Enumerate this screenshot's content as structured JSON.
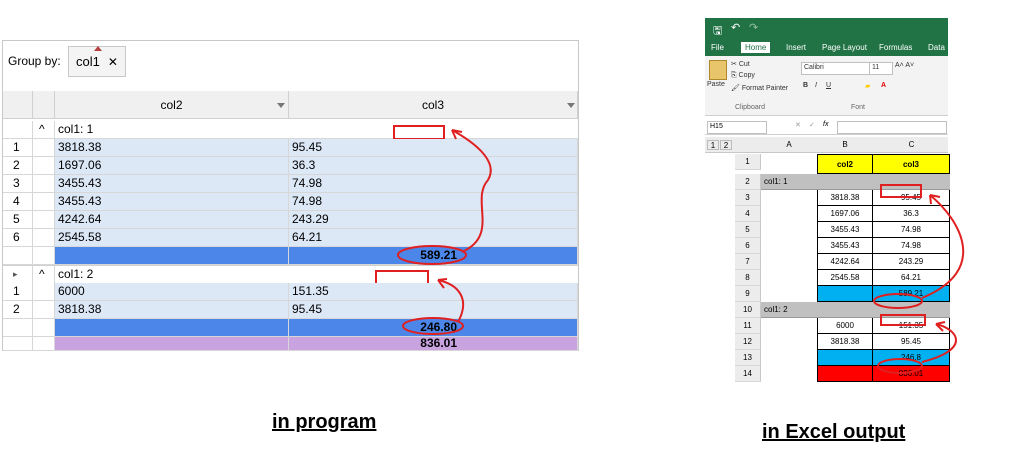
{
  "program": {
    "group_by_label": "Group by:",
    "group_chip": {
      "label": "col1",
      "close": "✕"
    },
    "columns": [
      "col2",
      "col3"
    ],
    "groups": [
      {
        "label": "col1: 1",
        "rows": [
          {
            "idx": "1",
            "col2": "3818.38",
            "col3": "95.45"
          },
          {
            "idx": "2",
            "col2": "1697.06",
            "col3": "36.3"
          },
          {
            "idx": "3",
            "col2": "3455.43",
            "col3": "74.98"
          },
          {
            "idx": "4",
            "col2": "3455.43",
            "col3": "74.98"
          },
          {
            "idx": "5",
            "col2": "4242.64",
            "col3": "243.29"
          },
          {
            "idx": "6",
            "col2": "2545.58",
            "col3": "64.21"
          }
        ],
        "sum": "589.21"
      },
      {
        "label": "col1: 2",
        "rows": [
          {
            "idx": "1",
            "col2": "6000",
            "col3": "151.35"
          },
          {
            "idx": "2",
            "col2": "3818.38",
            "col3": "95.45"
          }
        ],
        "sum": "246.80"
      }
    ],
    "total": "836.01"
  },
  "captions": {
    "left": "in program",
    "right": "in Excel output"
  },
  "excel": {
    "tabs": [
      "File",
      "Home",
      "Insert",
      "Page Layout",
      "Formulas",
      "Data"
    ],
    "clipboard": {
      "paste": "Paste",
      "cut": "Cut",
      "copy": "Copy",
      "format_painter": "Format Painter",
      "group": "Clipboard"
    },
    "font": {
      "name": "Calibri",
      "size": "11",
      "group": "Font"
    },
    "name_box": "H15",
    "fx": "fx",
    "outline_levels": [
      "1",
      "2"
    ],
    "col_headers": [
      "A",
      "B",
      "C"
    ],
    "rows": [
      {
        "n": "1",
        "a": "",
        "b": "col2",
        "c": "col3",
        "type": "header"
      },
      {
        "n": "2",
        "a": "col1: 1",
        "b": "",
        "c": "",
        "type": "group"
      },
      {
        "n": "3",
        "a": "",
        "b": "3818.38",
        "c": "95.45",
        "type": "data"
      },
      {
        "n": "4",
        "a": "",
        "b": "1697.06",
        "c": "36.3",
        "type": "data"
      },
      {
        "n": "5",
        "a": "",
        "b": "3455.43",
        "c": "74.98",
        "type": "data"
      },
      {
        "n": "6",
        "a": "",
        "b": "3455.43",
        "c": "74.98",
        "type": "data"
      },
      {
        "n": "7",
        "a": "",
        "b": "4242.64",
        "c": "243.29",
        "type": "data"
      },
      {
        "n": "8",
        "a": "",
        "b": "2545.58",
        "c": "64.21",
        "type": "data"
      },
      {
        "n": "9",
        "a": "",
        "b": "",
        "c": "589.21",
        "type": "sum"
      },
      {
        "n": "10",
        "a": "col1: 2",
        "b": "",
        "c": "",
        "type": "group"
      },
      {
        "n": "11",
        "a": "",
        "b": "6000",
        "c": "151.35",
        "type": "data"
      },
      {
        "n": "12",
        "a": "",
        "b": "3818.38",
        "c": "95.45",
        "type": "data"
      },
      {
        "n": "13",
        "a": "",
        "b": "",
        "c": "246.8",
        "type": "sum"
      },
      {
        "n": "14",
        "a": "",
        "b": "",
        "c": "836.01",
        "type": "total"
      }
    ],
    "colors": {
      "ribbon": "#217346",
      "header_fill": "#ffff00",
      "group_fill": "#c0c0c0",
      "sum_fill": "#00b0f0",
      "total_fill": "#ff0000"
    }
  }
}
